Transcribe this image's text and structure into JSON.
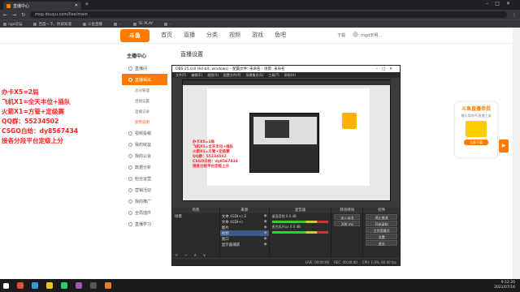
{
  "browser": {
    "tab_title": "直播中心",
    "url": "msp.douyu.com/live/main",
    "bookmarks": [
      "nga论坛",
      "百度一下，你就知道",
      "斗鱼直播",
      "...",
      "5E PLAY",
      "..."
    ]
  },
  "site": {
    "logo_text": "斗鱼",
    "nav": [
      "首页",
      "直播",
      "分类",
      "视频",
      "游戏",
      "鱼吧"
    ],
    "download": "下载",
    "username": "mgd天明..."
  },
  "sidebar": {
    "title": "主播中心",
    "items": [
      {
        "label": "直播间",
        "active": false
      },
      {
        "label": "直播相关",
        "active": true
      },
      {
        "label": "视频投稿",
        "active": false
      },
      {
        "label": "我的收益",
        "active": false
      },
      {
        "label": "我的公会",
        "active": false
      },
      {
        "label": "数据分析",
        "active": false
      },
      {
        "label": "粉丝运营",
        "active": false
      },
      {
        "label": "营销活动",
        "active": false
      },
      {
        "label": "我的推广",
        "active": false
      },
      {
        "label": "全局插件",
        "active": false
      },
      {
        "label": "直播学习",
        "active": false
      }
    ],
    "subitems": [
      {
        "label": "房间管理",
        "active": false
      },
      {
        "label": "直播设置",
        "active": false
      },
      {
        "label": "直播记录",
        "active": false
      },
      {
        "label": "使用说明",
        "active": true
      }
    ]
  },
  "content": {
    "title": "直播设置"
  },
  "overlay_text": [
    "办卡X5=2局",
    "飞机X1=全天丰位+插队",
    "火箭X1=方管+定级赛",
    "QQ群：55234502",
    "CSGO白给：dy8567434",
    "接各分段平台定级上分"
  ],
  "ad": {
    "title": "斗鱼直播伴侣",
    "subtitle": "最好用的PC直播工具",
    "button": "立即下载"
  },
  "obs": {
    "title": "OBS 25.0.8 (64-bit, windows) - 配置文件: 未命名 - 场景: 未命名",
    "menu": [
      "文件(F)",
      "编辑(E)",
      "视图(V)",
      "配置文件(P)",
      "场景集合(S)",
      "工具(T)",
      "帮助(H)"
    ],
    "panels": {
      "scenes": "场景",
      "sources": "来源",
      "mixer": "混音器",
      "transitions": "转场特效",
      "controls": "控件"
    },
    "scene_items": [
      "场景"
    ],
    "source_items": [
      {
        "label": "文本 (GDI+) 2",
        "selected": false
      },
      {
        "label": "文本 (GDI+)",
        "selected": false
      },
      {
        "label": "图片",
        "selected": false
      },
      {
        "label": "视频",
        "selected": true
      },
      {
        "label": "窗口",
        "selected": false
      },
      {
        "label": "显示器捕获",
        "selected": false
      }
    ],
    "mixer_items": [
      {
        "label": "桌面音频",
        "level": "0.0 dB"
      },
      {
        "label": "麦克风/Aux",
        "level": "0.0 dB"
      }
    ],
    "controls": [
      "停止推流",
      "开始录制",
      "工作室模式",
      "设置",
      "退出"
    ],
    "transition": {
      "type": "淡入淡出",
      "duration": "300 ms"
    },
    "status": {
      "live": "LIVE: 00:00:00",
      "rec": "REC: 00:00:00",
      "cpu": "CPU: 1.0%, 60.00 fps"
    }
  },
  "tray": {
    "time": "9:12:20",
    "date": "2021/07/16"
  }
}
